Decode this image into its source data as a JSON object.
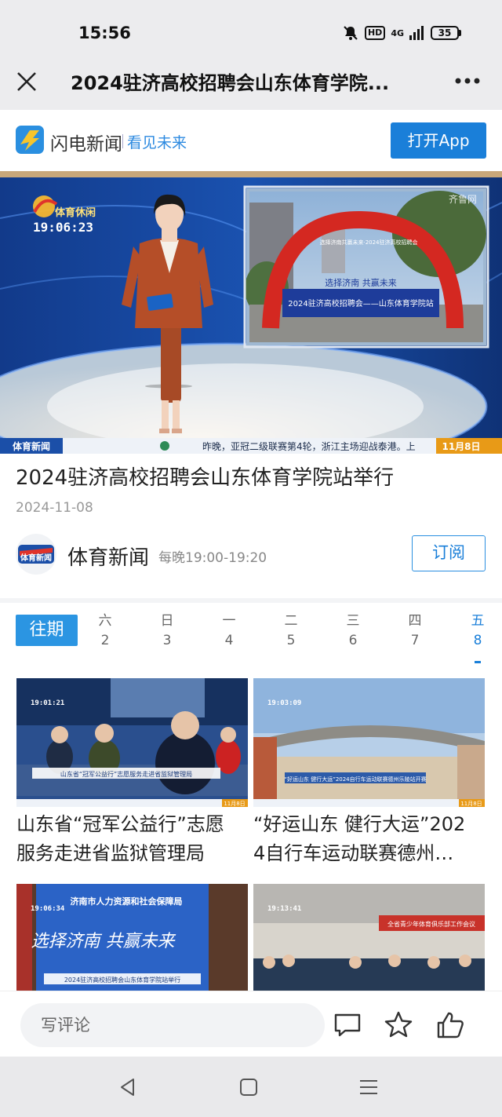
{
  "status_bar": {
    "time": "15:56",
    "hd": "HD",
    "network": "4G",
    "battery": "35"
  },
  "title_bar": {
    "title": "2024驻济高校招聘会山东体育学院..."
  },
  "app_banner": {
    "name": "闪电新闻",
    "slogan": "看见未来",
    "open_label": "打开App"
  },
  "video": {
    "logo_text": "体育休闲",
    "timecode": "19:06:23",
    "screen_banner": "2024驻济高校招聘会——山东体育学院站",
    "screen_slogan": "选择济南 共赢未来",
    "arch_text": "选择济南共赢未来·2024驻济高校招聘会",
    "watermark": "齐鲁网",
    "ticker_channel": "体育新闻",
    "ticker_text": "昨晚，亚冠二级联赛第4轮，浙江主场迎战泰港。上",
    "ticker_date": "11月8日"
  },
  "article": {
    "title": "2024驻济高校招聘会山东体育学院站举行",
    "date": "2024-11-08"
  },
  "channel": {
    "name": "体育新闻",
    "logo_text": "体育新闻",
    "schedule": "每晚19:00-19:20",
    "subscribe_label": "订阅"
  },
  "date_strip": {
    "past_label": "往期",
    "days": [
      {
        "dow": "六",
        "num": "2"
      },
      {
        "dow": "日",
        "num": "3"
      },
      {
        "dow": "一",
        "num": "4"
      },
      {
        "dow": "二",
        "num": "5"
      },
      {
        "dow": "三",
        "num": "6"
      },
      {
        "dow": "四",
        "num": "7"
      },
      {
        "dow": "五",
        "num": "8"
      }
    ],
    "active_index": 6
  },
  "cards": [
    {
      "line1": "山东省“冠军公益行”志愿",
      "line2": "服务走进省监狱管理局",
      "timecode": "19:01:21",
      "caption": "山东省“冠军公益行”志愿服务走进省监狱管理局",
      "badge": "11月8日"
    },
    {
      "line1": "“好运山东 健行大运”202",
      "line2": "4自行车运动联赛德州…",
      "timecode": "19:03:09",
      "caption": "“好运山东 健行大运”2024自行车运动联赛德州乐陵站开赛",
      "badge": "11月8日"
    },
    {
      "line1": "",
      "line2": "",
      "timecode": "19:06:34",
      "caption": "2024驻济高校招聘会山东体育学院站举行",
      "board_title": "济南市人力资源和社会保障局",
      "board_slogan": "选择济南 共赢未来"
    },
    {
      "line1": "",
      "line2": "",
      "timecode": "19:13:41",
      "board_title": "全省青少年体育俱乐部工作会议"
    }
  ],
  "bottom_bar": {
    "comment_placeholder": "写评论"
  },
  "colors": {
    "accent": "#1a7fd9",
    "status_bg": "#ececee",
    "nav_bg": "#e9e9eb"
  }
}
